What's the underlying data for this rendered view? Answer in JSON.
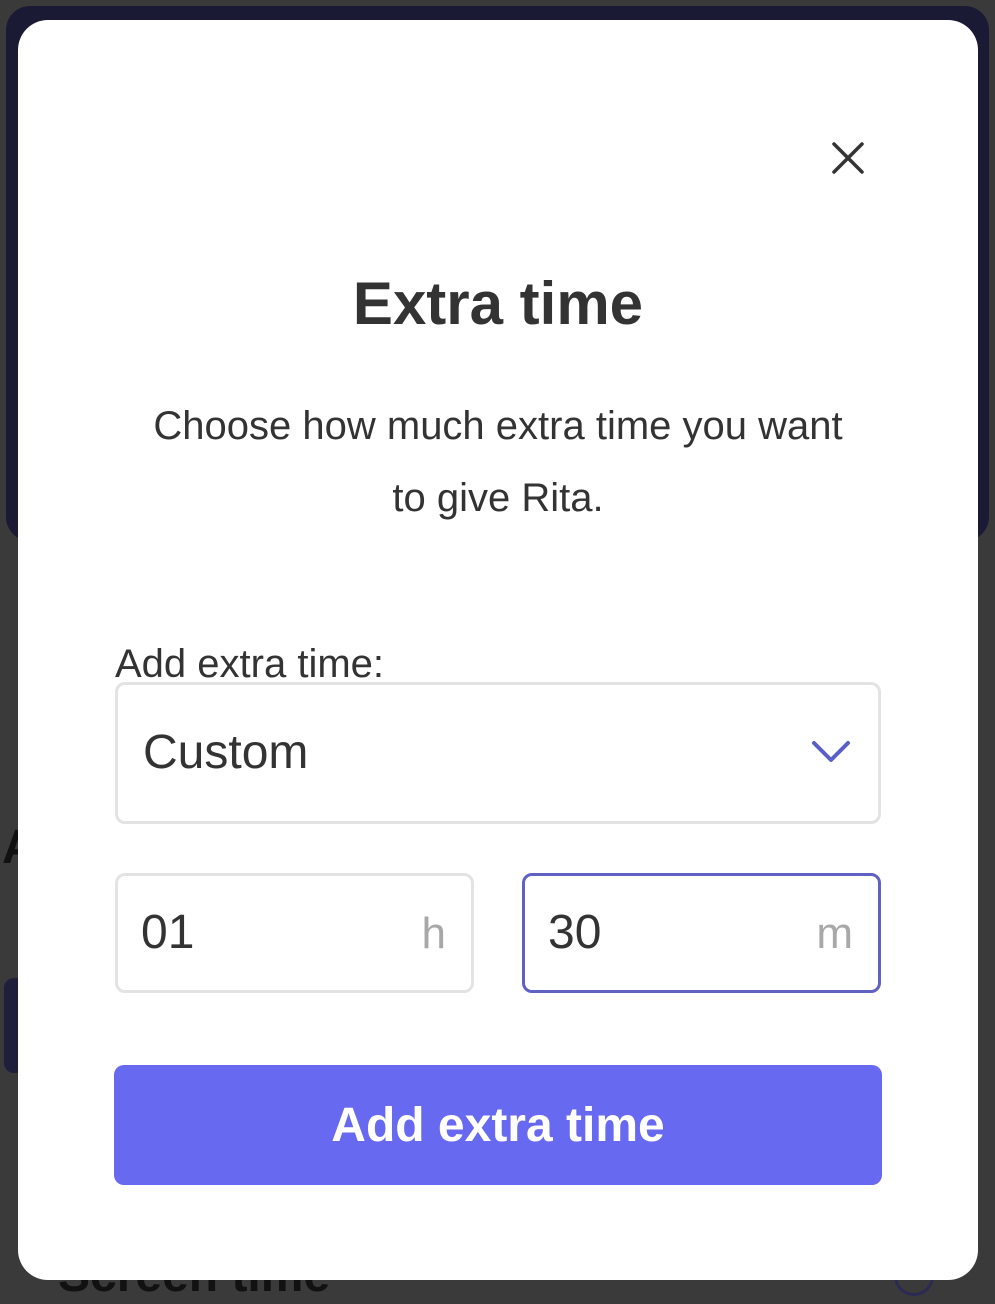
{
  "background": {
    "bottom_title": "Screen time"
  },
  "modal": {
    "title": "Extra time",
    "description": "Choose how much extra time you want to give Rita.",
    "add_label": "Add extra time:",
    "duration_select": {
      "selected": "Custom"
    },
    "hours": {
      "value": "01",
      "unit": "h"
    },
    "minutes": {
      "value": "30",
      "unit": "m"
    },
    "submit_label": "Add extra time"
  },
  "colors": {
    "accent": "#6769f0",
    "focus_border": "#5f62c2",
    "chevron": "#5b5fc7",
    "text": "#333333"
  },
  "icons": {
    "close": "close-icon",
    "dropdown": "chevron-down-icon"
  }
}
